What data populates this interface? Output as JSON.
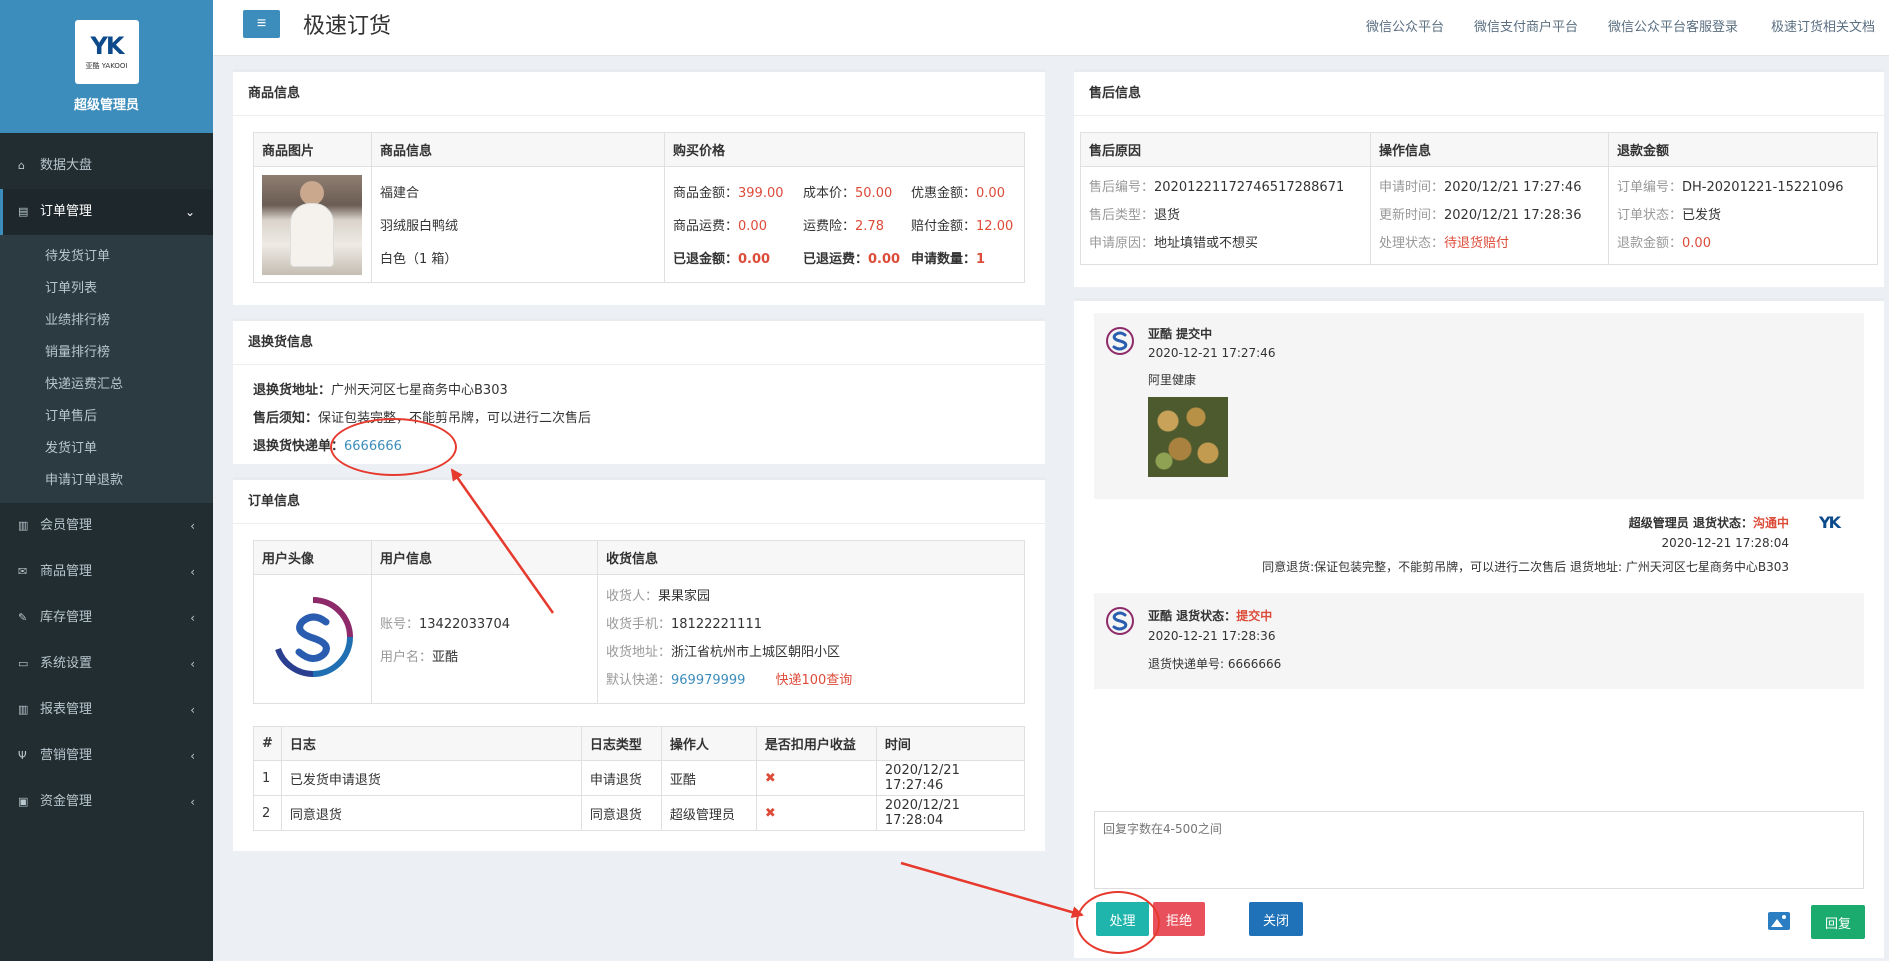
{
  "sidebar": {
    "logo_mark": "YK",
    "logo_sub": "亚酷 YAKOOI",
    "admin_name": "超级管理员",
    "items": [
      {
        "label": "数据大盘",
        "icon": "home-icon"
      },
      {
        "label": "订单管理",
        "icon": "order-icon"
      },
      {
        "label": "会员管理",
        "icon": "bar-chart-icon"
      },
      {
        "label": "商品管理",
        "icon": "envelope-icon"
      },
      {
        "label": "库存管理",
        "icon": "edit-icon"
      },
      {
        "label": "系统设置",
        "icon": "monitor-icon"
      },
      {
        "label": "报表管理",
        "icon": "bar-chart-icon"
      },
      {
        "label": "营销管理",
        "icon": "utensils-icon"
      },
      {
        "label": "资金管理",
        "icon": "money-icon"
      }
    ],
    "submenu": [
      "待发货订单",
      "订单列表",
      "业绩排行榜",
      "销量排行榜",
      "快递运费汇总",
      "订单售后",
      "发货订单",
      "申请订单退款"
    ]
  },
  "topbar": {
    "menu_icon": "≡",
    "title": "极速订货",
    "links": [
      "微信公众平台",
      "微信支付商户平台",
      "微信公众平台客服登录",
      "极速订货相关文档"
    ]
  },
  "product": {
    "title": "商品信息",
    "headers": [
      "商品图片",
      "商品信息",
      "购买价格"
    ],
    "info": [
      "福建合",
      "羽绒服白鸭绒",
      "白色（1 箱）"
    ],
    "prices": [
      [
        {
          "k": "商品金额：",
          "v": "399.00"
        },
        {
          "k": "成本价：",
          "v": "50.00"
        },
        {
          "k": "优惠金额：",
          "v": "0.00"
        }
      ],
      [
        {
          "k": "商品运费：",
          "v": "0.00"
        },
        {
          "k": "运费险：",
          "v": "2.78"
        },
        {
          "k": "赔付金额：",
          "v": "12.00"
        }
      ],
      [
        {
          "k": "已退金额：",
          "v": "0.00"
        },
        {
          "k": "已退运费：",
          "v": "0.00"
        },
        {
          "k": "申请数量：",
          "v": "1"
        }
      ]
    ]
  },
  "return_info": {
    "title": "退换货信息",
    "address_label": "退换货地址：",
    "address": "广州天河区七星商务中心B303",
    "notice_label": "售后须知：",
    "notice": "保证包装完整，不能剪吊牌，可以进行二次售后",
    "tracking_label": "退换货快递单：",
    "tracking": "6666666"
  },
  "order_info": {
    "title": "订单信息",
    "headers": [
      "用户头像",
      "用户信息",
      "收货信息"
    ],
    "account_label": "账号：",
    "account": "13422033704",
    "username_label": "用户名：",
    "username": "亚酷",
    "receiver_label": "收货人：",
    "receiver": "果果家园",
    "phone_label": "收货手机：",
    "phone": "18122221111",
    "address_label": "收货地址：",
    "address": "浙江省杭州市上城区朝阳小区",
    "express_label": "默认快递：",
    "express": "969979999",
    "express_query": "快递100查询",
    "log_headers": [
      "#",
      "日志",
      "日志类型",
      "操作人",
      "是否扣用户收益",
      "时间"
    ],
    "logs": [
      {
        "n": "1",
        "log": "已发货申请退货",
        "type": "申请退货",
        "op": "亚酷",
        "deduct": "✖",
        "time": "2020/12/21 17:27:46"
      },
      {
        "n": "2",
        "log": "同意退货",
        "type": "同意退货",
        "op": "超级管理员",
        "deduct": "✖",
        "time": "2020/12/21 17:28:04"
      }
    ]
  },
  "after_sale": {
    "title": "售后信息",
    "headers": [
      "售后原因",
      "操作信息",
      "退款金额"
    ],
    "no_label": "售后编号：",
    "no": "20201221172746517288671",
    "type_label": "售后类型：",
    "type": "退货",
    "reason_label": "申请原因：",
    "reason": "地址填错或不想买",
    "apply_time_label": "申请时间：",
    "apply_time": "2020/12/21 17:27:46",
    "update_time_label": "更新时间：",
    "update_time": "2020/12/21 17:28:36",
    "status_label": "处理状态：",
    "status": "待退货赔付",
    "order_no_label": "订单编号：",
    "order_no": "DH-20201221-15221096",
    "order_status_label": "订单状态：",
    "order_status": "已发货",
    "refund_label": "退款金额：",
    "refund": "0.00"
  },
  "chat": {
    "m1_name": "亚酷 提交中",
    "m1_time": "2020-12-21 17:27:46",
    "m1_text": "阿里健康",
    "m2_name": "超级管理员 退货状态：",
    "m2_status": "沟通中",
    "m2_time": "2020-12-21 17:28:04",
    "m2_text": "同意退货:保证包装完整，不能剪吊牌，可以进行二次售后 退货地址: 广州天河区七星商务中心B303",
    "m3_name": "亚酷 退货状态：",
    "m3_status": "提交中",
    "m3_time": "2020-12-21 17:28:36",
    "m3_text": "退货快递单号: 6666666",
    "reply_placeholder": "回复字数在4-500之间",
    "btn_process": "处理",
    "btn_reject": "拒绝",
    "btn_close": "关闭",
    "btn_reply": "回复"
  },
  "colors": {
    "primary": "#3c8dbc",
    "danger": "#dd4b39",
    "teal": "#1fb5ac",
    "pink": "#e8505b",
    "green": "#1cab6e",
    "sidebar": "#222d32",
    "annotation": "#e63a2e"
  }
}
